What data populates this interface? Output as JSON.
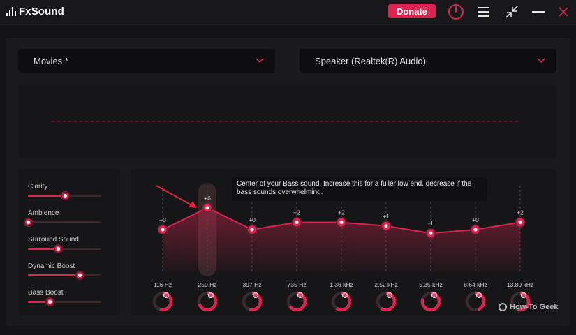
{
  "app": {
    "title": "FxSound"
  },
  "titlebar": {
    "donate_label": "Donate"
  },
  "preset": {
    "value": "Movies *"
  },
  "output_device": {
    "value": "Speaker (Realtek(R) Audio)"
  },
  "effects": [
    {
      "label": "Clarity",
      "value": 0.51
    },
    {
      "label": "Ambience",
      "value": 0.0
    },
    {
      "label": "Surround Sound",
      "value": 0.41
    },
    {
      "label": "Dynamic Boost",
      "value": 0.71
    },
    {
      "label": "Bass Boost",
      "value": 0.3
    }
  ],
  "eq": {
    "selected_band": 1,
    "tooltip": "Center of your Bass sound. Increase this for a fuller low end, decrease if the bass sounds overwhelming.",
    "bands": [
      {
        "freq": "116 Hz",
        "gain": 0,
        "gain_label": "+0"
      },
      {
        "freq": "250 Hz",
        "gain": 6,
        "gain_label": "+6"
      },
      {
        "freq": "397 Hz",
        "gain": 0,
        "gain_label": "+0"
      },
      {
        "freq": "735 Hz",
        "gain": 2,
        "gain_label": "+2"
      },
      {
        "freq": "1.36 kHz",
        "gain": 2,
        "gain_label": "+2"
      },
      {
        "freq": "2.52 kHz",
        "gain": 1,
        "gain_label": "+1"
      },
      {
        "freq": "5.35 kHz",
        "gain": -1,
        "gain_label": "-1"
      },
      {
        "freq": "8.64 kHz",
        "gain": 0,
        "gain_label": "+0"
      },
      {
        "freq": "13.80 kHz",
        "gain": 2,
        "gain_label": "+2"
      }
    ],
    "knob_levels": [
      0.55,
      0.7,
      0.55,
      0.65,
      0.6,
      0.6,
      0.8,
      0.45,
      0.55
    ]
  },
  "colors": {
    "accent": "#d9254f",
    "background": "#141416",
    "panel": "#1a1a1c"
  },
  "watermark": {
    "text": "How-To Geek"
  },
  "icons": [
    "power-icon",
    "menu-icon",
    "minimize-view-icon",
    "minimize-icon",
    "close-icon",
    "chevron-down-icon"
  ]
}
